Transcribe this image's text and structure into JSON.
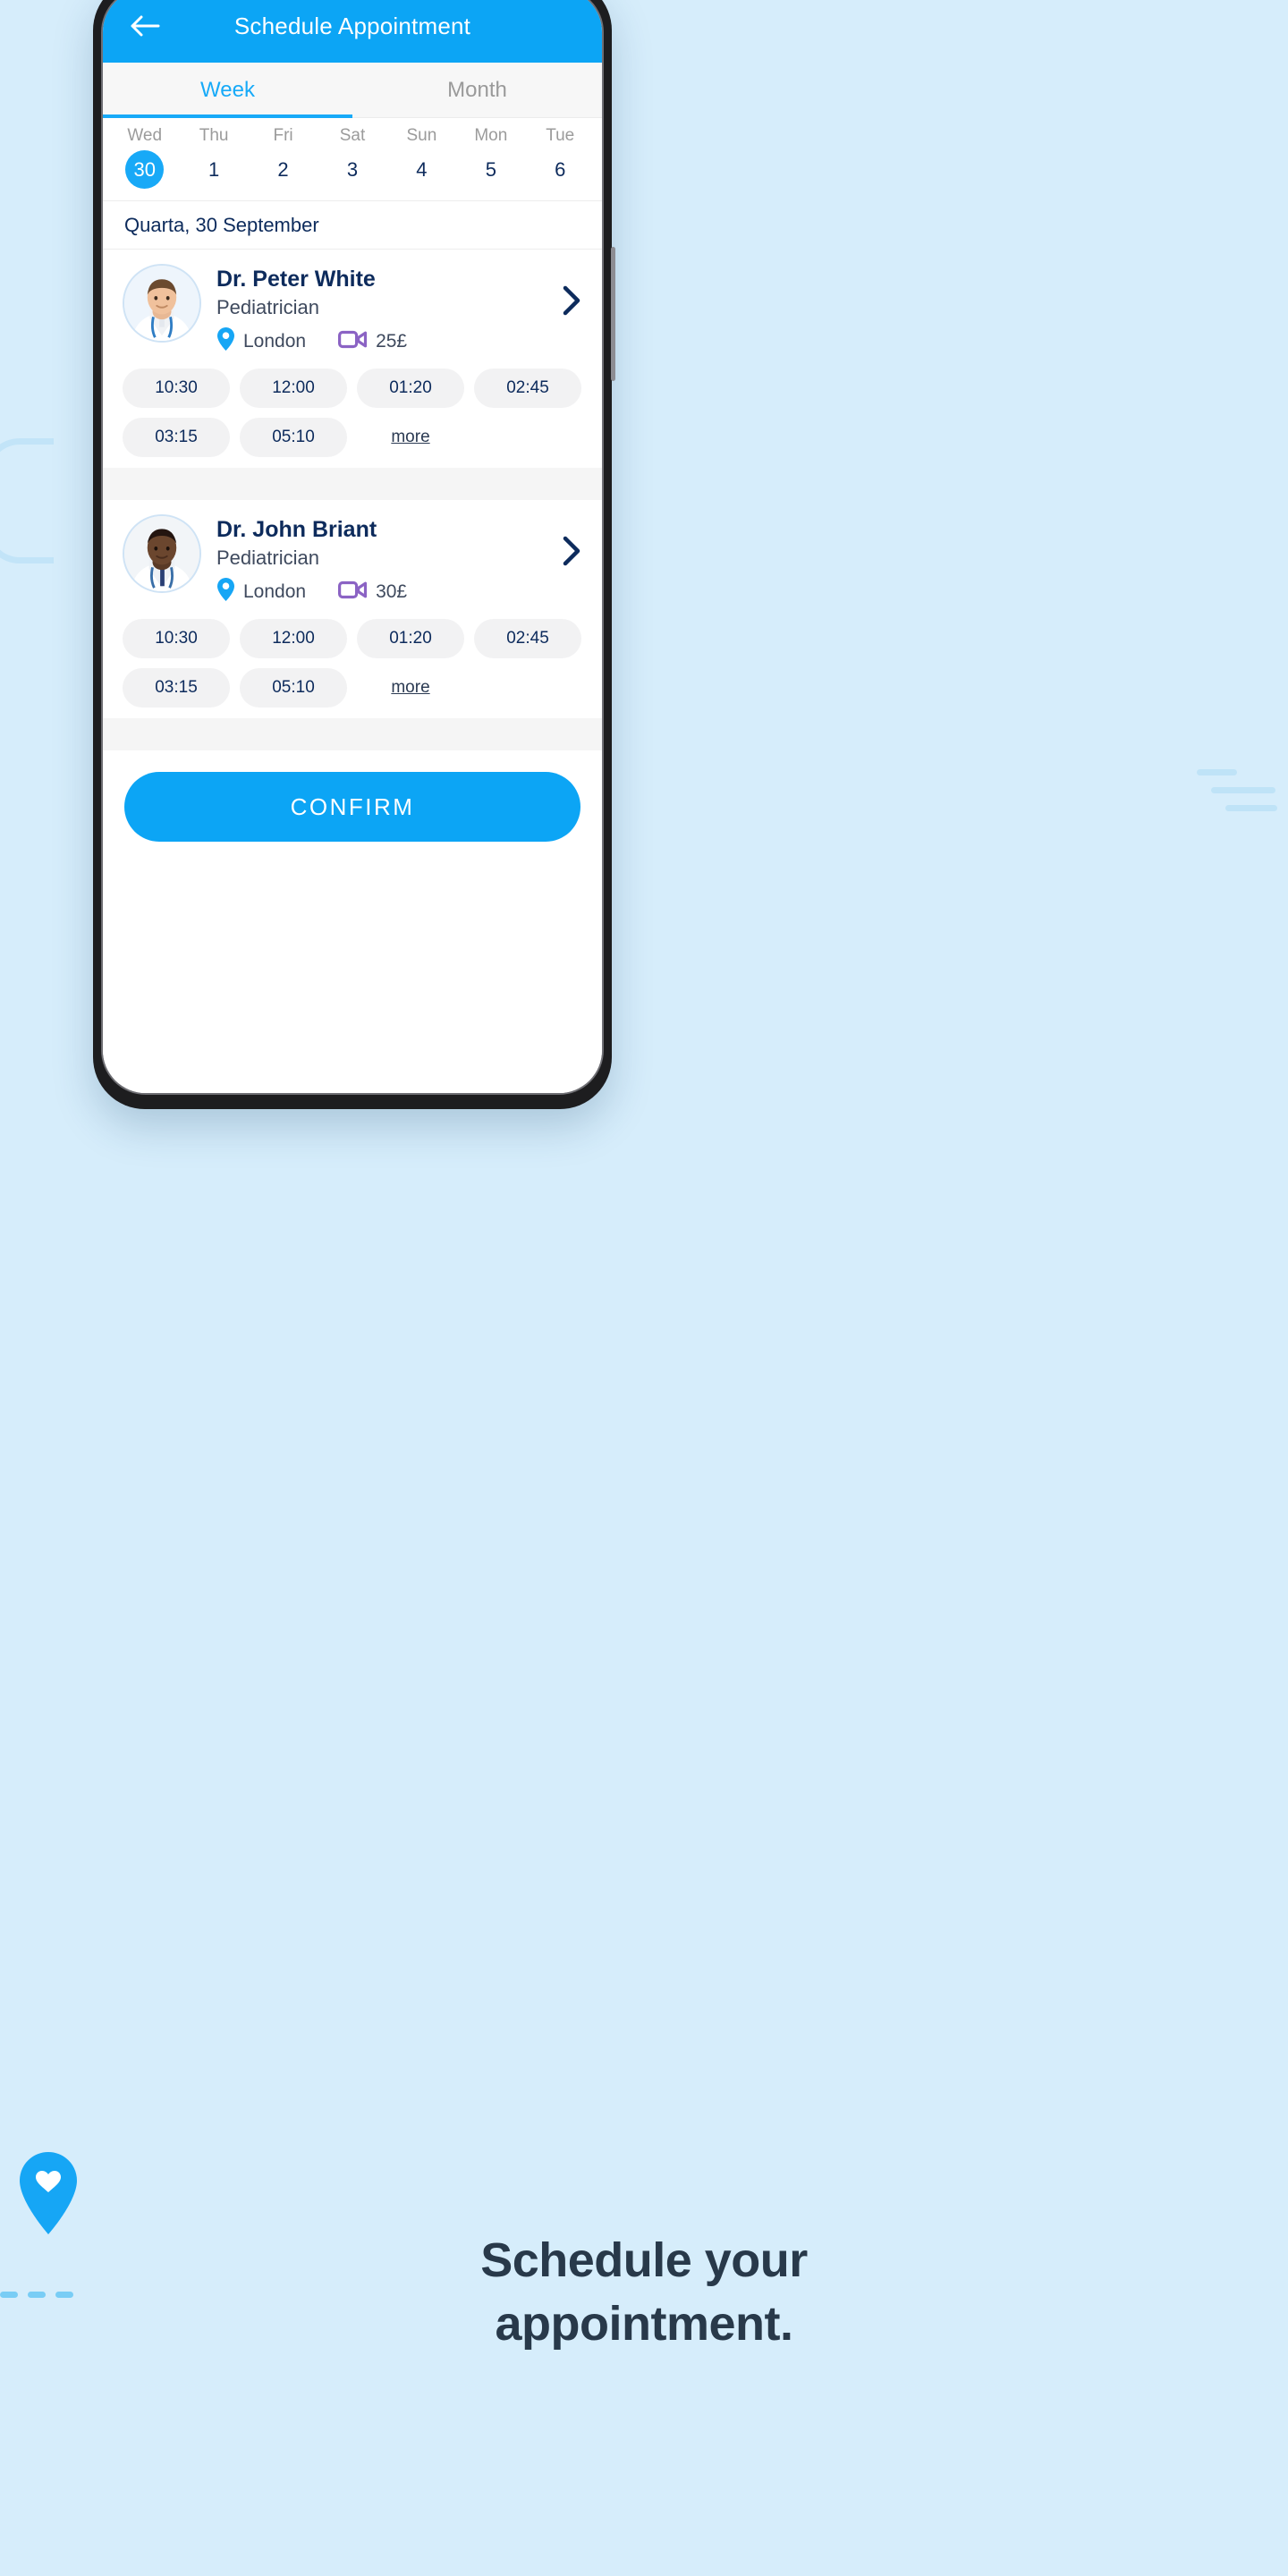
{
  "theme": {
    "accent": "#0ca5f5",
    "accent_light": "#18a9f7",
    "navy": "#0d2b5c",
    "purple": "#8b63c4",
    "page_bg": "#d6edfb",
    "slot_bg": "#f2f2f3"
  },
  "header": {
    "title": "Schedule Appointment",
    "back_icon": "arrow-left-icon"
  },
  "tabs": [
    {
      "label": "Week",
      "active": true
    },
    {
      "label": "Month",
      "active": false
    }
  ],
  "week_strip": [
    {
      "name": "Wed",
      "num": "30",
      "selected": true
    },
    {
      "name": "Thu",
      "num": "1",
      "selected": false
    },
    {
      "name": "Fri",
      "num": "2",
      "selected": false
    },
    {
      "name": "Sat",
      "num": "3",
      "selected": false
    },
    {
      "name": "Sun",
      "num": "4",
      "selected": false
    },
    {
      "name": "Mon",
      "num": "5",
      "selected": false
    },
    {
      "name": "Tue",
      "num": "6",
      "selected": false
    }
  ],
  "date_label": "Quarta, 30 September",
  "doctors": [
    {
      "name": "Dr. Peter White",
      "specialty": "Pediatrician",
      "location": "London",
      "location_icon": "map-pin-icon",
      "price": "25£",
      "price_icon": "video-camera-icon",
      "chevron_icon": "chevron-right-icon",
      "avatar_icon": "doctor-avatar-white-male",
      "slots": [
        "10:30",
        "12:00",
        "01:20",
        "02:45",
        "03:15",
        "05:10"
      ],
      "more_label": "more"
    },
    {
      "name": "Dr. John Briant",
      "specialty": "Pediatrician",
      "location": "London",
      "location_icon": "map-pin-icon",
      "price": "30£",
      "price_icon": "video-camera-icon",
      "chevron_icon": "chevron-right-icon",
      "avatar_icon": "doctor-avatar-black-male",
      "slots": [
        "10:30",
        "12:00",
        "01:20",
        "02:45",
        "03:15",
        "05:10"
      ],
      "more_label": "more"
    }
  ],
  "confirm_label": "CONFIRM",
  "caption": {
    "line1": "Schedule your",
    "line2": "appointment."
  },
  "pin_badge_icon": "heart-map-pin-icon"
}
